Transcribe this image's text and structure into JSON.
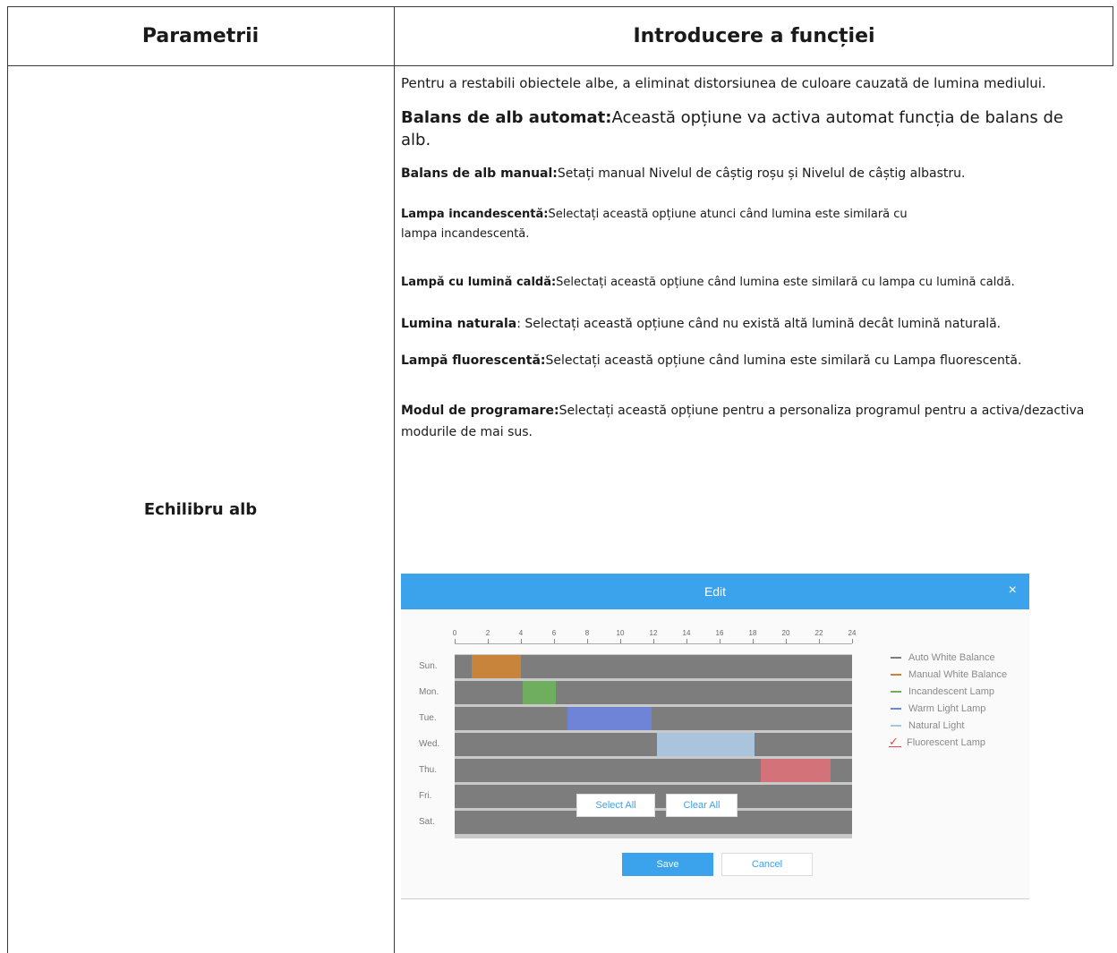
{
  "table": {
    "header_left": "Parametrii",
    "header_right": "Introducere a funcției",
    "row_label": "Echilibru alb"
  },
  "content": {
    "intro": "Pentru a restabili obiectele albe, a eliminat distorsiunea de culoare cauzată de lumina mediului.",
    "items": [
      {
        "term": "Balans de alb automat:",
        "desc": "Această opțiune va activa automat funcția de balans de alb."
      },
      {
        "term": "Balans de alb manual:",
        "desc": "Setați manual Nivelul de câștig roșu și Nivelul de câștig albastru."
      },
      {
        "term": "Lampa incandescentă:",
        "desc": "Selectați această opțiune atunci când lumina este similară cu",
        "desc2": "lampa incandescentă."
      },
      {
        "term": "Lampă cu lumină caldă:",
        "desc": "Selectați această opțiune când lumina este similară cu lampa cu lumină caldă."
      },
      {
        "term": "Lumina naturala",
        "desc": ": Selectați această opțiune când nu există altă lumină decât lumină naturală."
      },
      {
        "term": "Lampă fluorescentă:",
        "desc": "Selectați această opțiune când lumina este similară cu Lampa fluorescentă."
      },
      {
        "term": "Modul de programare:",
        "desc": "Selectați această opțiune pentru a personaliza programul pentru a activa/dezactiva modurile de mai sus."
      }
    ]
  },
  "dialog": {
    "title": "Edit",
    "close_glyph": "×",
    "hours": [
      "0",
      "2",
      "4",
      "6",
      "8",
      "10",
      "12",
      "14",
      "16",
      "18",
      "20",
      "22",
      "24"
    ],
    "days": [
      "Sun.",
      "Mon.",
      "Tue.",
      "Wed.",
      "Thu.",
      "Fri.",
      "Sat."
    ],
    "schedule": [
      {
        "day": "Sun.",
        "start": 1,
        "end": 4,
        "mode": "Manual White Balance"
      },
      {
        "day": "Mon.",
        "start": 4.1,
        "end": 6.1,
        "mode": "Incandescent Lamp"
      },
      {
        "day": "Tue.",
        "start": 6.8,
        "end": 11.9,
        "mode": "Warm Light Lamp"
      },
      {
        "day": "Wed.",
        "start": 12.2,
        "end": 18.1,
        "mode": "Natural Light"
      },
      {
        "day": "Thu.",
        "start": 18.5,
        "end": 22.7,
        "mode": "Fluorescent Lamp"
      }
    ],
    "legend": [
      {
        "label": "Auto White Balance",
        "color": "#7d7d7d"
      },
      {
        "label": "Manual White Balance",
        "color": "#c8843a"
      },
      {
        "label": "Incandescent Lamp",
        "color": "#6fae5e"
      },
      {
        "label": "Warm Light Lamp",
        "color": "#6f84d6"
      },
      {
        "label": "Natural Light",
        "color": "#a9c4dc"
      },
      {
        "label": "Fluorescent Lamp",
        "color": "#d4727a",
        "selected": true
      }
    ],
    "buttons": {
      "select_all": "Select All",
      "clear_all": "Clear All",
      "save": "Save",
      "cancel": "Cancel"
    }
  }
}
